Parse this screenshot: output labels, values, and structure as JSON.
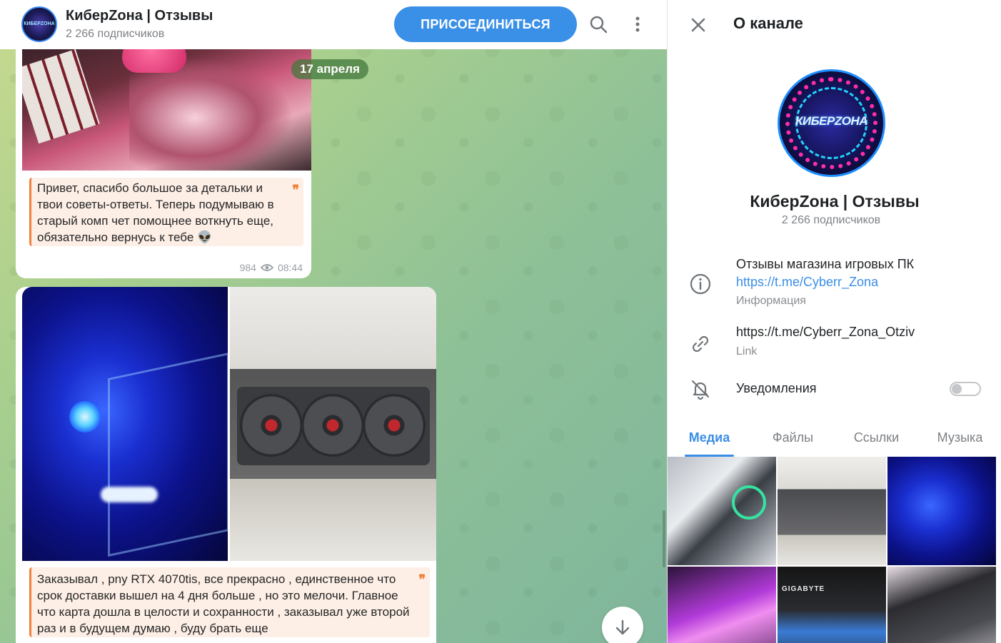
{
  "header": {
    "title": "КиберZона | Отзывы",
    "subscribers": "2 266 подписчиков",
    "join_label": "ПРИСОЕДИНИТЬСЯ",
    "avatar_text": "КИБЕРZОНА"
  },
  "chat": {
    "date_pill": "17 апреля",
    "messages": [
      {
        "text": "Привет, спасибо большое за детальки и твои советы-ответы. Теперь подумываю в старый комп чет помощнее воткнуть еще, обязательно вернусь к тебе 👽",
        "views": "984",
        "time": "08:44"
      },
      {
        "text": "Заказывал , pny RTX 4070tis, все прекрасно , единственное что срок доставки вышел на 4 дня больше , но это мелочи. Главное что карта дошла в целости и сохранности  , заказывал уже второй раз и в будущем думаю , буду брать еще"
      }
    ],
    "quote_mark": "❞"
  },
  "panel": {
    "title": "О канале",
    "avatar_text": "КИБЕРZОНА",
    "name": "КиберZона | Отзывы",
    "subscribers": "2 266 подписчиков",
    "info": {
      "description": "Отзывы магазина игровых ПК ",
      "description_link": "https://t.me/Cyberr_Zona",
      "caption": "Информация"
    },
    "link": {
      "value": "https://t.me/Cyberr_Zona_Otziv",
      "caption": "Link"
    },
    "notifications": {
      "label": "Уведомления",
      "enabled": false
    },
    "tabs": [
      {
        "label": "Медиа",
        "active": true
      },
      {
        "label": "Файлы",
        "active": false
      },
      {
        "label": "Ссылки",
        "active": false
      },
      {
        "label": "Музыка",
        "active": false
      }
    ],
    "media_tile_brand": "GIGABYTE"
  },
  "colors": {
    "accent": "#3a90e6",
    "quote_border": "#f0813a",
    "quote_bg": "#fdefe6"
  }
}
